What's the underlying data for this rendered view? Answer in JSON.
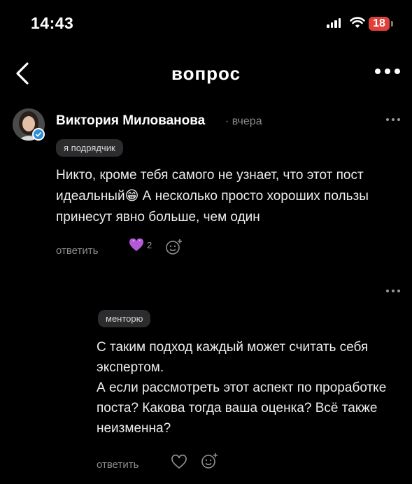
{
  "status_bar": {
    "time": "14:43",
    "battery": "18"
  },
  "header": {
    "title": "вопрос"
  },
  "comment": {
    "author": "Виктория Милованова",
    "time": "· вчера",
    "role_tag": "я подрядчик",
    "text": "Никто, кроме тебя самого не узнает, что этот пост идеальный😁 А несколько просто хороших пользы принесут явно больше, чем один",
    "reply_label": "ответить",
    "reaction_count": "2"
  },
  "reply": {
    "tag": "менторю",
    "text": "С таким подход каждый может считать себя экспертом.\nА если рассмотреть этот аспект по проработке поста? Какова тогда ваша оценка? Всё также неизменна?",
    "reply_label": "ответить"
  },
  "colors": {
    "background": "#000000",
    "badge": "#e0403a",
    "tag_bg": "#2c2c2e"
  }
}
